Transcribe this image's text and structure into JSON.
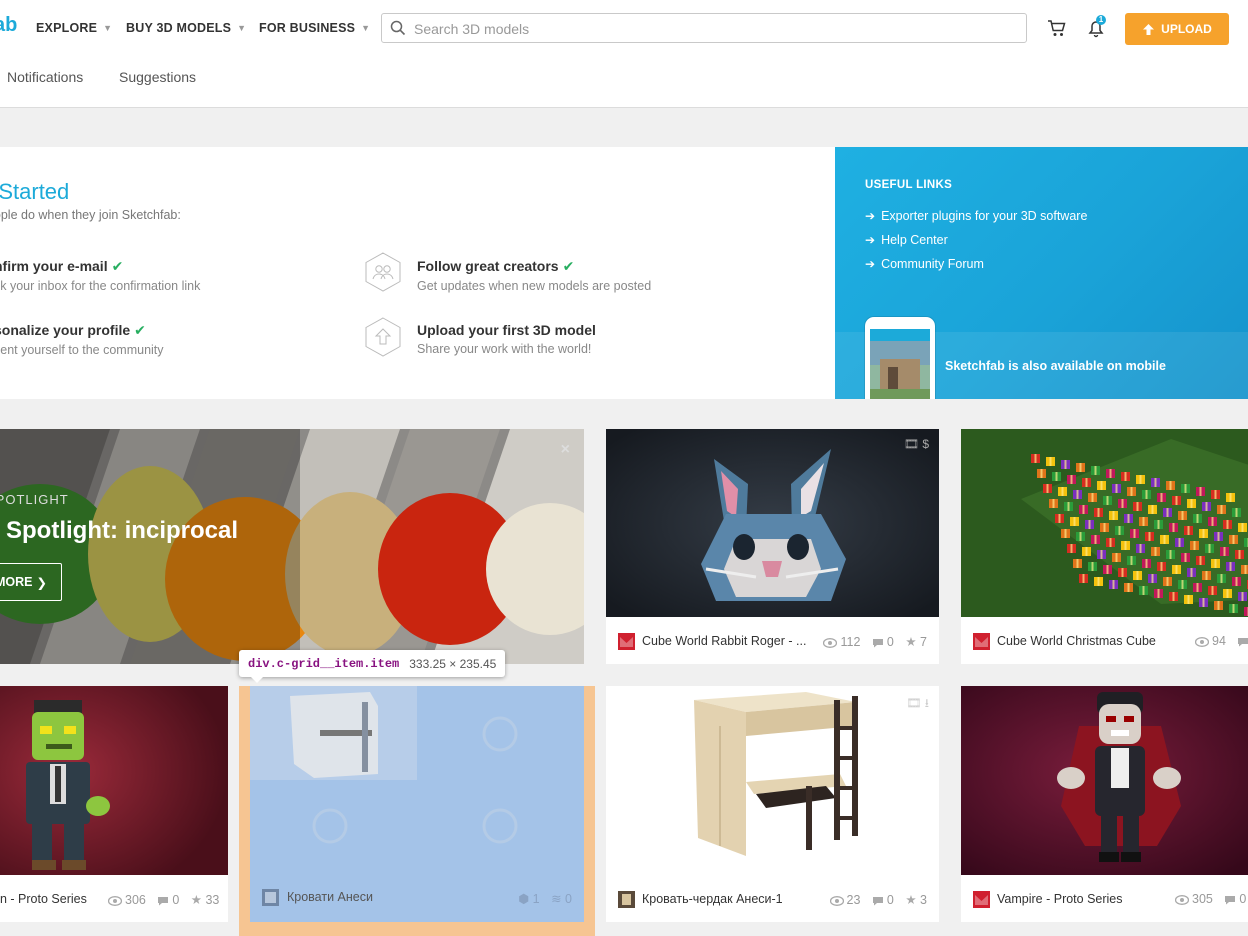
{
  "header": {
    "logo_tail": "ab",
    "nav": {
      "explore": "EXPLORE",
      "buy": "BUY 3D MODELS",
      "business": "FOR BUSINESS"
    },
    "search_placeholder": "Search 3D models",
    "notification_count": "1",
    "upload": "UPLOAD",
    "tabs": {
      "notifications": "Notifications",
      "suggestions": "Suggestions"
    }
  },
  "getting_started": {
    "title": "g Started",
    "subtitle": "people do when they join Sketchfab:",
    "steps": [
      {
        "title": "nfirm your e-mail",
        "desc": "ck your inbox for the confirmation link",
        "done": true
      },
      {
        "title": "Follow great creators",
        "desc": "Get updates when new models are posted",
        "done": true,
        "icon": "people-icon"
      },
      {
        "title": "sonalize your profile",
        "desc": "sent yourself to the community",
        "done": true
      },
      {
        "title": "Upload your first 3D model",
        "desc": "Share your work with the world!",
        "done": false,
        "icon": "upload-icon"
      }
    ]
  },
  "useful_links": {
    "heading": "USEFUL LINKS",
    "items": [
      "Exporter plugins for your 3D software",
      "Help Center",
      "Community Forum"
    ],
    "mobile": "Sketchfab is also available on mobile"
  },
  "spotlight": {
    "label": "SPOTLIGHT",
    "title": "r Spotlight: inciprocal",
    "more": "MORE"
  },
  "cards": [
    {
      "title": "Cube World Rabbit Roger - ...",
      "views": "112",
      "comments": "0",
      "likes": "7"
    },
    {
      "title": "Cube World Christmas Cube ...",
      "views": "94",
      "comments": ""
    },
    {
      "title": "n - Proto Series",
      "views": "306",
      "comments": "0",
      "likes": "33"
    },
    {
      "title": "Кровати Анеси",
      "views": "1",
      "comments": "0"
    },
    {
      "title": "Кровать-чердак Анеси-1",
      "views": "23",
      "comments": "0",
      "likes": "3"
    },
    {
      "title": "Vampire - Proto Series",
      "views": "305",
      "comments": "0"
    }
  ],
  "devtools_tooltip": {
    "selector": "div.c-grid__item.item",
    "size": "333.25 × 235.45"
  },
  "colors": {
    "accent": "#1caad9",
    "upload": "#f6a22c",
    "check": "#27ae60",
    "highlight_content": "#a4c3e8",
    "highlight_padding": "#f6c592"
  }
}
